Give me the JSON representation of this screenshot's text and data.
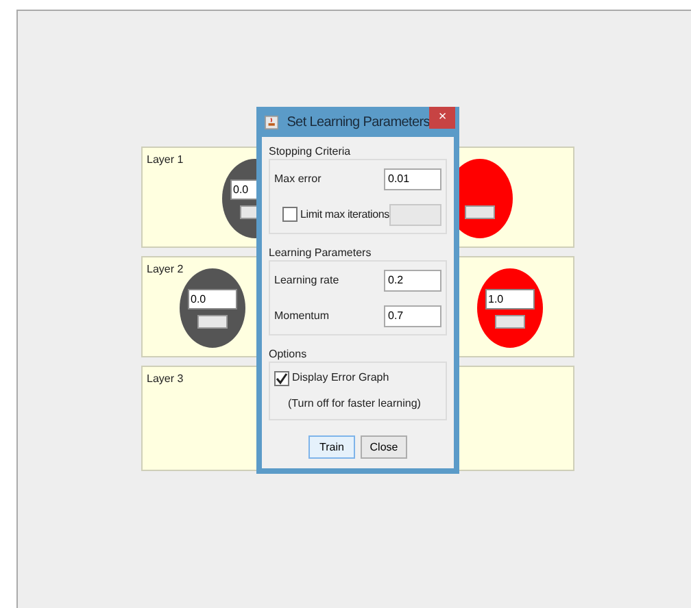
{
  "layers": [
    {
      "label": "Layer 1",
      "neurons": [
        {
          "value": "0.0",
          "color": "#555555"
        },
        {
          "color": "#ff0000"
        }
      ]
    },
    {
      "label": "Layer 2",
      "neurons": [
        {
          "value": "0.0",
          "color": "#555555"
        },
        {
          "value": "1.0",
          "color": "#ff0000"
        }
      ]
    },
    {
      "label": "Layer 3"
    }
  ],
  "dialog": {
    "title": "Set Learning Parameters",
    "close": "×",
    "groups": [
      {
        "title": "Stopping Criteria",
        "rows": [
          {
            "kind": "field",
            "label": "Max error",
            "value": "0.01",
            "disabled": false
          },
          {
            "kind": "checkfield",
            "label": "Limit max iterations",
            "checked": false,
            "disabled": true
          }
        ]
      },
      {
        "title": "Learning Parameters",
        "rows": [
          {
            "kind": "field",
            "label": "Learning rate",
            "value": "0.2",
            "disabled": false
          },
          {
            "kind": "field",
            "label": "Momentum",
            "value": "0.7",
            "disabled": false
          }
        ]
      },
      {
        "title": "Options",
        "rows": [
          {
            "kind": "check",
            "label": "Display Error Graph",
            "checked": true
          },
          {
            "kind": "note",
            "label": "(Turn off for faster learning)"
          }
        ]
      }
    ],
    "buttons": [
      {
        "label": "Train",
        "selected": true
      },
      {
        "label": "Close",
        "selected": false
      }
    ]
  }
}
